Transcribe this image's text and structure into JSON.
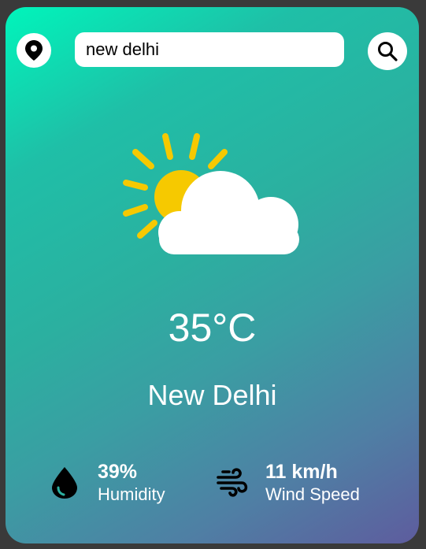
{
  "search": {
    "value": "new delhi"
  },
  "weather": {
    "icon": "partly-cloudy-icon",
    "temperature": "35°C",
    "city": "New Delhi"
  },
  "details": {
    "humidity": {
      "value": "39%",
      "label": "Humidity",
      "icon": "water-drop-icon"
    },
    "wind": {
      "value": "11 km/h",
      "label": "Wind Speed",
      "icon": "wind-icon"
    }
  },
  "colors": {
    "gradient_start": "#00f5bb",
    "gradient_end": "#5e5c9e",
    "sun": "#f6c900",
    "cloud": "#ffffff"
  }
}
